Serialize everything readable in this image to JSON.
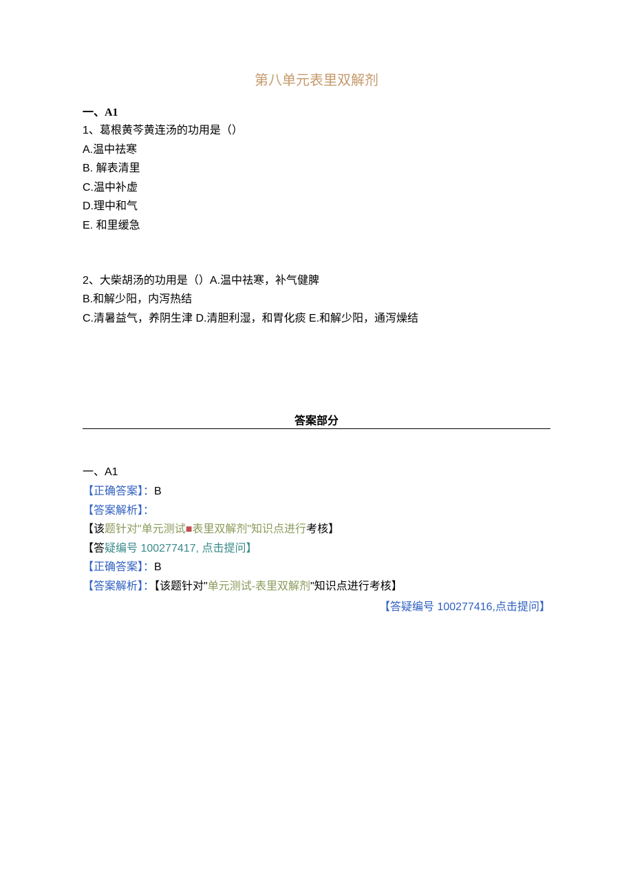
{
  "title": "第八单元表里双解剂",
  "questions": {
    "section_label": "一、A1",
    "q1": {
      "stem": "1、葛根黄芩黄连汤的功用是（）",
      "opts": {
        "a": "A.温中祛寒",
        "b": "B. 解表清里",
        "c": "C.温中补虚",
        "d": "D.理中和气",
        "e": "E. 和里缓急"
      }
    },
    "q2": {
      "line1": "2、大柴胡汤的功用是（）A.温中祛寒，补气健脾",
      "line2": "B.和解少阳，内泻热结",
      "line3": "C.清暑益气，养阴生津 D.清胆利湿，和胃化痰 E.和解少阳，通泻燥结"
    }
  },
  "answers": {
    "header": "答案部分",
    "section_label": "一、A1",
    "a1": {
      "correct_label": "【正确答案】：",
      "correct_value": "B",
      "analysis_label": "【答案解析】：",
      "point_open": "【该",
      "point_mid1": "题针对\"单元测试",
      "point_square": "■",
      "point_mid2": "表里双解剂\"知识点进行",
      "point_end": "考核】",
      "faq_open": "【答",
      "faq_mid1": "疑编号 100277417, ",
      "faq_click": "点击",
      "faq_mid2": "提问】"
    },
    "a2": {
      "correct_label": "【正确答案】：",
      "correct_value": "B",
      "analysis_label": "【答案解析】：",
      "point_text": "【该题针对\"",
      "point_green": "单元测试-表里双解剂",
      "point_end": "\"知识点进行考核】",
      "faq_full": "【答疑编号 100277416,点击提问】"
    }
  }
}
